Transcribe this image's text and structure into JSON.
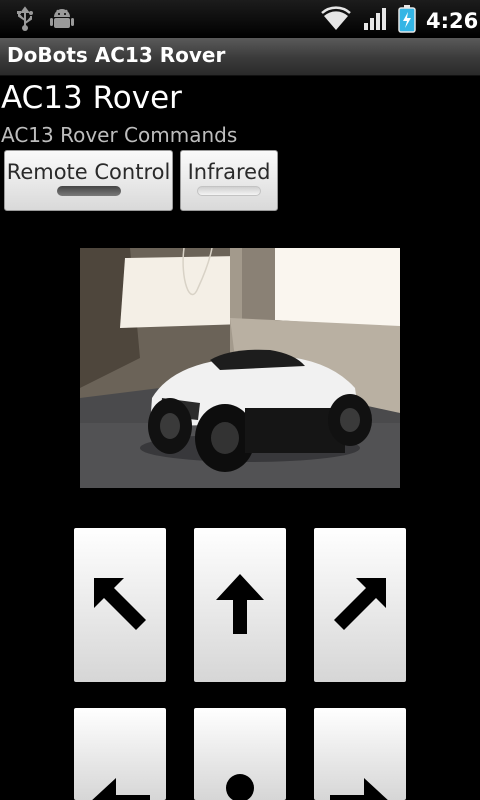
{
  "status_bar": {
    "left_icons": [
      "usb-icon",
      "android-debug-icon"
    ],
    "right_icons": [
      "wifi-icon",
      "signal-icon",
      "battery-charging-icon"
    ],
    "time": "4:26"
  },
  "app": {
    "title": "DoBots AC13 Rover",
    "heading": "AC13 Rover",
    "subheading": "AC13 Rover Commands"
  },
  "mode_buttons": [
    {
      "label": "Remote Control",
      "active": true
    },
    {
      "label": "Infrared",
      "active": false
    }
  ],
  "camera": {
    "description_icon": "camera-feed"
  },
  "direction_pad": [
    {
      "name": "up-left",
      "icon": "arrow-up-left-icon"
    },
    {
      "name": "up",
      "icon": "arrow-up-icon"
    },
    {
      "name": "up-right",
      "icon": "arrow-up-right-icon"
    },
    {
      "name": "left",
      "icon": "arrow-left-icon"
    },
    {
      "name": "stop",
      "icon": "stop-dot-icon"
    },
    {
      "name": "right",
      "icon": "arrow-right-icon"
    }
  ],
  "colors": {
    "background": "#000000",
    "accent_battery": "#33b5e5"
  }
}
